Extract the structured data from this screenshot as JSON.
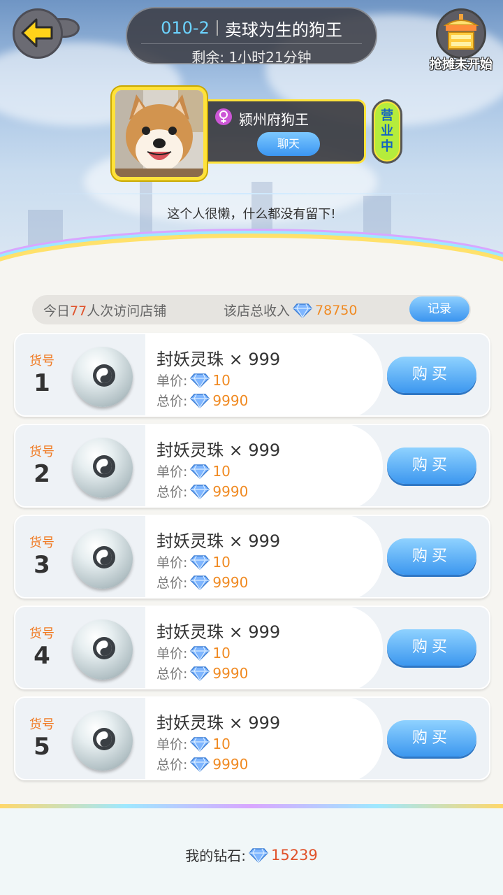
{
  "header": {
    "shop_code": "010-2",
    "shop_name": "卖球为生的狗王",
    "remaining": "剩余: 1小时21分钟",
    "stall_status": "抢摊未开始"
  },
  "owner": {
    "name": "颍州府狗王",
    "chat_label": "聊天",
    "status_badge": "营业中",
    "bio": "这个人很懒，什么都没有留下!"
  },
  "stats": {
    "visits_prefix": "今日",
    "visits_count": "77",
    "visits_suffix": "人次访问店铺",
    "income_label": "该店总收入",
    "income_value": "78750",
    "record_label": "记录"
  },
  "items": [
    {
      "no_label": "货号",
      "no": "1",
      "name": "封妖灵珠 × 999",
      "unit_label": "单价:",
      "unit_price": "10",
      "total_label": "总价:",
      "total_price": "9990",
      "buy_label": "购买"
    },
    {
      "no_label": "货号",
      "no": "2",
      "name": "封妖灵珠 × 999",
      "unit_label": "单价:",
      "unit_price": "10",
      "total_label": "总价:",
      "total_price": "9990",
      "buy_label": "购买"
    },
    {
      "no_label": "货号",
      "no": "3",
      "name": "封妖灵珠 × 999",
      "unit_label": "单价:",
      "unit_price": "10",
      "total_label": "总价:",
      "total_price": "9990",
      "buy_label": "购买"
    },
    {
      "no_label": "货号",
      "no": "4",
      "name": "封妖灵珠 × 999",
      "unit_label": "单价:",
      "unit_price": "10",
      "total_label": "总价:",
      "total_price": "9990",
      "buy_label": "购买"
    },
    {
      "no_label": "货号",
      "no": "5",
      "name": "封妖灵珠 × 999",
      "unit_label": "单价:",
      "unit_price": "10",
      "total_label": "总价:",
      "total_price": "9990",
      "buy_label": "购买"
    }
  ],
  "footer": {
    "diamonds_label": "我的钻石:",
    "diamonds_value": "15239"
  },
  "colors": {
    "accent_blue": "#3c97ef",
    "price_orange": "#f08a22",
    "highlight_red": "#e0522b",
    "badge_green": "#b5ec3c",
    "frame_yellow": "#ffe23a"
  },
  "icons": [
    "back-arrow-icon",
    "stall-icon",
    "female-icon",
    "diamond-icon",
    "pearl-icon",
    "yin-yang-icon"
  ]
}
